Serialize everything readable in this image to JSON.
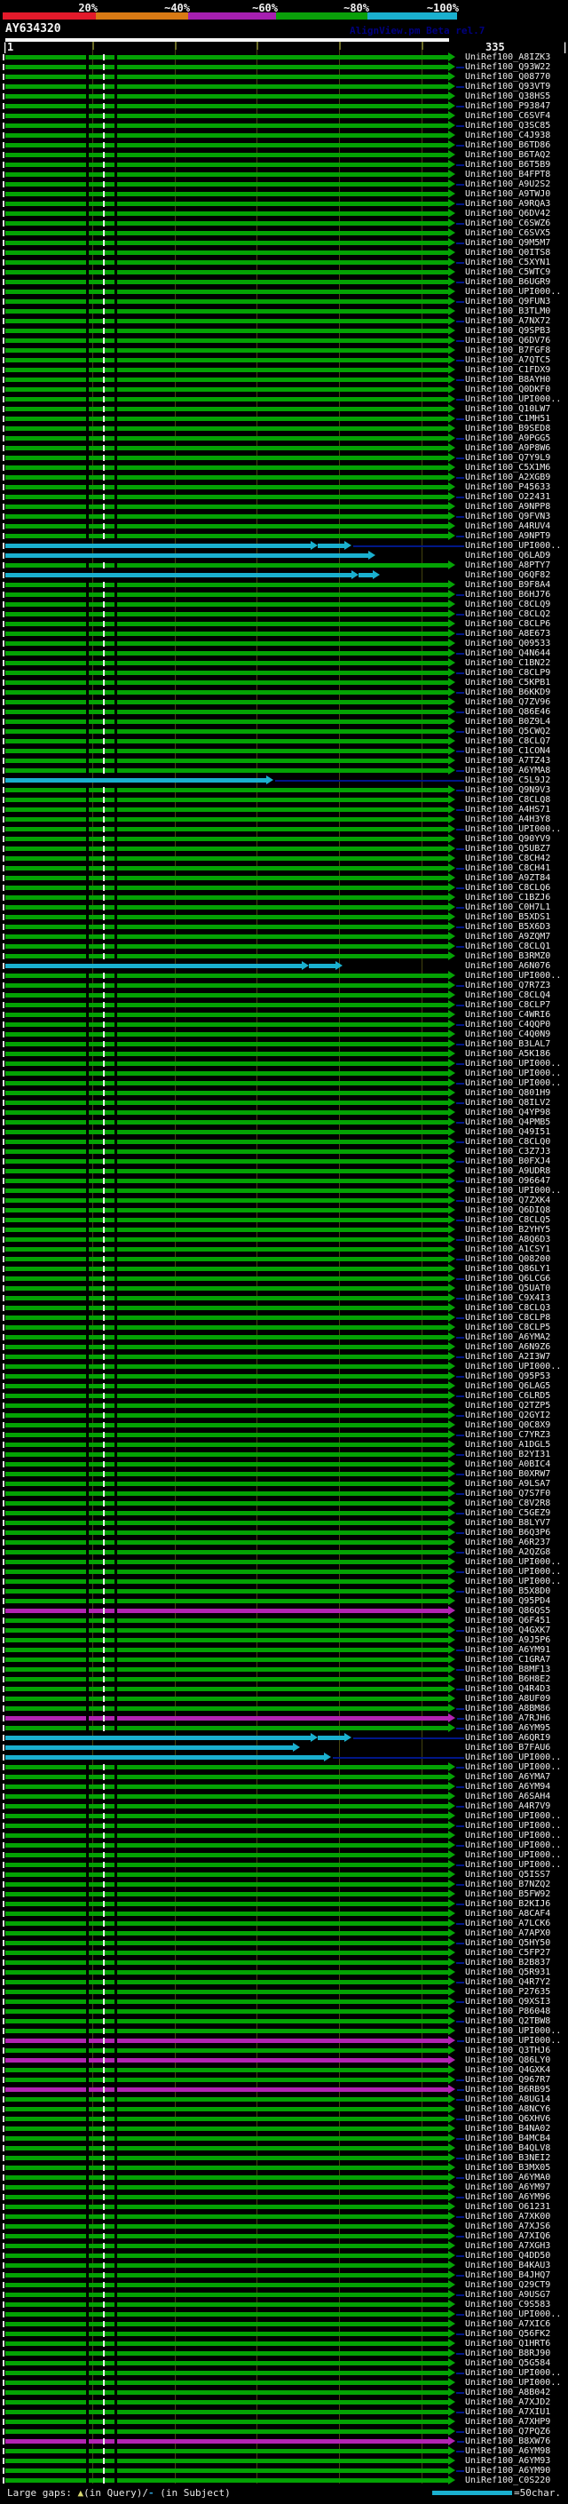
{
  "color_key": {
    "labels": [
      "20%",
      "~40%",
      "~60%",
      "~80%",
      "~100%"
    ],
    "colors": [
      "#e31a2b",
      "#d97a14",
      "#a61fb0",
      "#0aa00a",
      "#1ab0cf"
    ]
  },
  "query": {
    "name": "AY634320",
    "watermark": "AlignView.pm Beta rel.7",
    "scale_start": "1",
    "scale_end": "335"
  },
  "footer": {
    "legend_prefix": "Large gaps: ",
    "query_gap_symbol": "▲",
    "legend_mid": "(in Query)/",
    "subject_gap_symbol": "-",
    "legend_suffix": " (in Subject)",
    "ruler_label": "=50char."
  },
  "bar_colors": {
    "green": "#04a204",
    "cyan": "#1ab0cf",
    "magenta": "#b224b2",
    "connector": "#001788"
  },
  "hits": {
    "prefix": "UniRef100_",
    "rows": [
      "A8IZK3",
      "Q93W22",
      "Q08770",
      "Q93VT9",
      "Q38HS5",
      "P93847",
      "C6SVF4",
      "Q3SC85",
      "C4J938",
      "B6TD86",
      "B6TAQ2",
      "B6T5B9",
      "B4FPT8",
      "A9U2S2",
      "A9TWJ0",
      "A9RQA3",
      "Q6DV42",
      "C6SWZ6",
      "C6SVX5",
      "Q9M5M7",
      "Q0ITS8",
      "C5XYN1",
      "C5WTC9",
      "B6UGR9",
      "UPI000..",
      "Q9FUN3",
      "B3TLM0",
      "A7NX72",
      "Q9SPB3",
      "Q6DV76",
      "B7FGF8",
      "A7QTC5",
      "C1FDX9",
      "B8AYH0",
      "Q0DKF0",
      "UPI000..",
      "Q10LW7",
      "C1MH51",
      "B9SED8",
      "A9PGG5",
      "A9P8W6",
      "Q7Y9L9",
      "C5X1M6",
      "A2XGB9",
      "P45633",
      "O22431",
      "A9NPP8",
      "Q9FVN3",
      "A4RUV4",
      "A9NPT9",
      {
        "id": "UPI000..",
        "color": "cyan",
        "segs": [
          [
            6,
            350
          ],
          [
            358,
            388
          ]
        ],
        "line": true
      },
      {
        "id": "Q6LAD9",
        "color": "cyan",
        "segs": [
          [
            6,
            415
          ]
        ]
      },
      "A8PTY7",
      {
        "id": "Q6QF82",
        "color": "cyan",
        "segs": [
          [
            6,
            396
          ],
          [
            404,
            420
          ]
        ]
      },
      "B9F8A4",
      "B6HJ76",
      "C8CLQ9",
      "C8CLQ2",
      "C8CLP6",
      "A8E673",
      "Q09533",
      "Q4N644",
      "C1BN22",
      "C8CLP9",
      "C5KPB1",
      "B6KKD9",
      "Q7ZV96",
      "Q86E46",
      "B0Z9L4",
      "Q5CWQ2",
      "C8CLQ7",
      "C1CON4",
      "A7TZ43",
      "A6YMA8",
      {
        "id": "C5L9J2",
        "color": "cyan",
        "segs": [
          [
            6,
            300
          ]
        ],
        "line": true
      },
      "Q9N9V3",
      "C8CLQ8",
      "A4HS71",
      "A4H3Y8",
      "UPI000..",
      "Q90YV9",
      "Q5UBZ7",
      "C8CH42",
      "C8CH41",
      "A9ZT84",
      "C8CLQ6",
      "C1BZJ6",
      "C0H7L1",
      "B5XDS1",
      "B5X6D3",
      "A9ZQM7",
      "C8CLQ1",
      "B3RMZ0",
      {
        "id": "A6N076",
        "color": "cyan",
        "segs": [
          [
            6,
            340
          ],
          [
            348,
            378
          ]
        ]
      },
      "UPI000..",
      "Q7R7Z3",
      "C8CLQ4",
      "C8CLP7",
      "C4WRI6",
      "C4QQP0",
      "C4Q0N9",
      "B3LAL7",
      "A5K186",
      "UPI000..",
      "UPI000..",
      "UPI000..",
      "Q801H9",
      "Q8ILV2",
      "Q4YP98",
      "Q4PMB5",
      "Q49I51",
      "C8CLQ0",
      "C3Z7J3",
      "B0FXJ4",
      "A9UDR8",
      "O96647",
      "UPI000..",
      "Q7ZXK4",
      "Q6DIQ8",
      "C8CLQ5",
      "B2YHY5",
      "A8Q6D3",
      "A1CSY1",
      "Q08200",
      "Q86LY1",
      "Q6LCG6",
      "Q5UAT0",
      "C9X4I3",
      "C8CLQ3",
      "C8CLP8",
      "C8CLP5",
      "A6YMA2",
      "A6N9Z6",
      "A2I3W7",
      "UPI000..",
      "Q95P53",
      "Q6LAG5",
      "C6LRD5",
      "Q2TZP5",
      "Q2GYI2",
      "Q0C8X9",
      "C7YRZ3",
      "A1DGL5",
      "B2YI31",
      "A0BIC4",
      "B0XRW7",
      "A9LSA7",
      "Q7S7F0",
      "C8V2R8",
      "C5GEZ9",
      "B8LYV7",
      "B6Q3P6",
      "A6R237",
      "A2QZG8",
      "UPI000..",
      "UPI000..",
      "UPI000..",
      "B5X8D0",
      "Q95PD4",
      {
        "id": "Q86QS5",
        "color": "magenta"
      },
      "Q6F451",
      "Q4GXK7",
      "A9J5P6",
      "A6YM91",
      "C1GRA7",
      "B8MF13",
      "B6H8E2",
      "Q4R4D3",
      "A8UF09",
      "A8BM86",
      {
        "id": "A7RJH6",
        "color": "magenta",
        "line": true
      },
      "A6YM95",
      {
        "id": "A6QRI9",
        "color": "cyan",
        "segs": [
          [
            6,
            350
          ],
          [
            358,
            388
          ]
        ],
        "line": true
      },
      {
        "id": "B7FAU6",
        "color": "cyan",
        "segs": [
          [
            6,
            330
          ]
        ]
      },
      {
        "id": "UPI000..",
        "color": "cyan",
        "segs": [
          [
            6,
            365
          ]
        ],
        "line": true
      },
      "UPI000..",
      "A6YMA7",
      "A6YM94",
      "A6SAH4",
      "A4R7V9",
      "UPI000..",
      "UPI000..",
      "UPI000..",
      "UPI000..",
      "UPI000..",
      "UPI000..",
      "Q5ISS7",
      "B7NZQ2",
      "B5FW92",
      "B2KIJ6",
      "A8CAF4",
      "A7LCK6",
      "A7APX0",
      "Q5HY50",
      "C5FP27",
      "B2B837",
      "Q5R931",
      "Q4R7Y2",
      "P27635",
      "Q9XSI3",
      "P86048",
      "Q2TBW8",
      "UPI000..",
      {
        "id": "UPI000..",
        "color": "magenta",
        "line": true
      },
      "Q3THJ6",
      {
        "id": "Q86LY0",
        "color": "magenta"
      },
      "Q4GXK4",
      "Q967R7",
      {
        "id": "B6RB95",
        "color": "magenta",
        "line": true
      },
      "A8UG14",
      "A8NCY6",
      "Q6XHV6",
      "B4NA02",
      "B4MCB4",
      "B4QLV8",
      "B3NEI2",
      "B3MX05",
      "A6YMA0",
      "A6YM97",
      "A6YM96",
      "O61231",
      "A7XK00",
      "A7XJS6",
      "A7XIQ6",
      "A7XGH3",
      "Q4DD50",
      "B4KAU3",
      "B4JHQ7",
      "Q29CT9",
      "A9USG7",
      "C9S583",
      "UPI000..",
      "A7XIC6",
      "Q56FK2",
      "Q1HRT6",
      "B8RJ90",
      "Q5G584",
      "UPI000..",
      "UPI000..",
      "A8B042",
      "A7XJD2",
      "A7XIU1",
      "A7XHP9",
      "Q7PQZ6",
      {
        "id": "B8XW76",
        "color": "magenta",
        "line": true
      },
      "A6YM98",
      "A6YM93",
      "A6YM90",
      "C0S220"
    ]
  }
}
